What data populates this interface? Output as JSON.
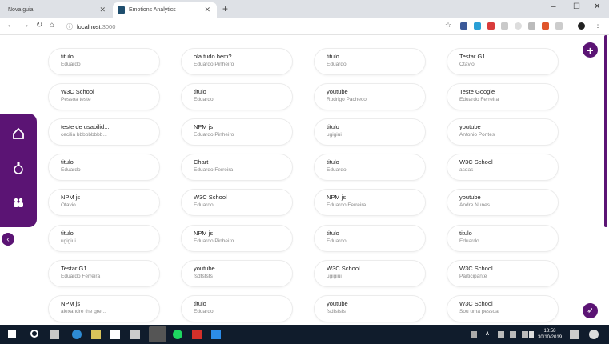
{
  "browser": {
    "tabs": [
      {
        "label": "Nova guia",
        "active": false
      },
      {
        "label": "Emotions Analytics",
        "active": true
      }
    ],
    "url_host": "localhost",
    "url_port": ":3000"
  },
  "cards": [
    {
      "title": "titulo",
      "subtitle": "Eduardo"
    },
    {
      "title": "ola tudo bem?",
      "subtitle": "Eduardo Pinheiro"
    },
    {
      "title": "titulo",
      "subtitle": "Eduardo"
    },
    {
      "title": "Testar G1",
      "subtitle": "Otavio"
    },
    {
      "title": "W3C School",
      "subtitle": "Pessoa teste"
    },
    {
      "title": "titulo",
      "subtitle": "Eduardo"
    },
    {
      "title": "youtube",
      "subtitle": "Rodrigo Pacheco"
    },
    {
      "title": "Teste Google",
      "subtitle": "Eduardo Ferreira"
    },
    {
      "title": "teste de usabilid...",
      "subtitle": "cecilia bbbbbbbbb..."
    },
    {
      "title": "NPM js",
      "subtitle": "Eduardo Pinheiro"
    },
    {
      "title": "titulo",
      "subtitle": "ugigiui"
    },
    {
      "title": "youtube",
      "subtitle": "Antonio Pontes"
    },
    {
      "title": "titulo",
      "subtitle": "Eduardo"
    },
    {
      "title": "Chart",
      "subtitle": "Eduardo Ferreira"
    },
    {
      "title": "titulo",
      "subtitle": "Eduardo"
    },
    {
      "title": "W3C School",
      "subtitle": "asdas"
    },
    {
      "title": "NPM js",
      "subtitle": "Otavio"
    },
    {
      "title": "W3C School",
      "subtitle": "Eduardo"
    },
    {
      "title": "NPM js",
      "subtitle": "Eduardo Ferreira"
    },
    {
      "title": "youtube",
      "subtitle": "Andre Nunes"
    },
    {
      "title": "titulo",
      "subtitle": "ugigiui"
    },
    {
      "title": "NPM js",
      "subtitle": "Eduardo Pinheiro"
    },
    {
      "title": "titulo",
      "subtitle": "Eduardo"
    },
    {
      "title": "titulo",
      "subtitle": "Eduardo"
    },
    {
      "title": "Testar G1",
      "subtitle": "Eduardo Ferreira"
    },
    {
      "title": "youtube",
      "subtitle": "fsdfsfsfs"
    },
    {
      "title": "W3C School",
      "subtitle": "ugigiui"
    },
    {
      "title": "W3C School",
      "subtitle": "Participante"
    },
    {
      "title": "NPM js",
      "subtitle": "alexandre the gre..."
    },
    {
      "title": "titulo",
      "subtitle": "Eduardo"
    },
    {
      "title": "youtube",
      "subtitle": "fsdfsfsfs"
    },
    {
      "title": "W3C School",
      "subtitle": "Sou uma pessoa"
    }
  ],
  "sidebar": {
    "items": [
      {
        "icon": "home-icon"
      },
      {
        "icon": "flask-icon"
      },
      {
        "icon": "users-icon"
      }
    ]
  },
  "taskbar": {
    "time": "18:58",
    "date": "30/10/2019"
  },
  "colors": {
    "accent": "#5b1474"
  }
}
